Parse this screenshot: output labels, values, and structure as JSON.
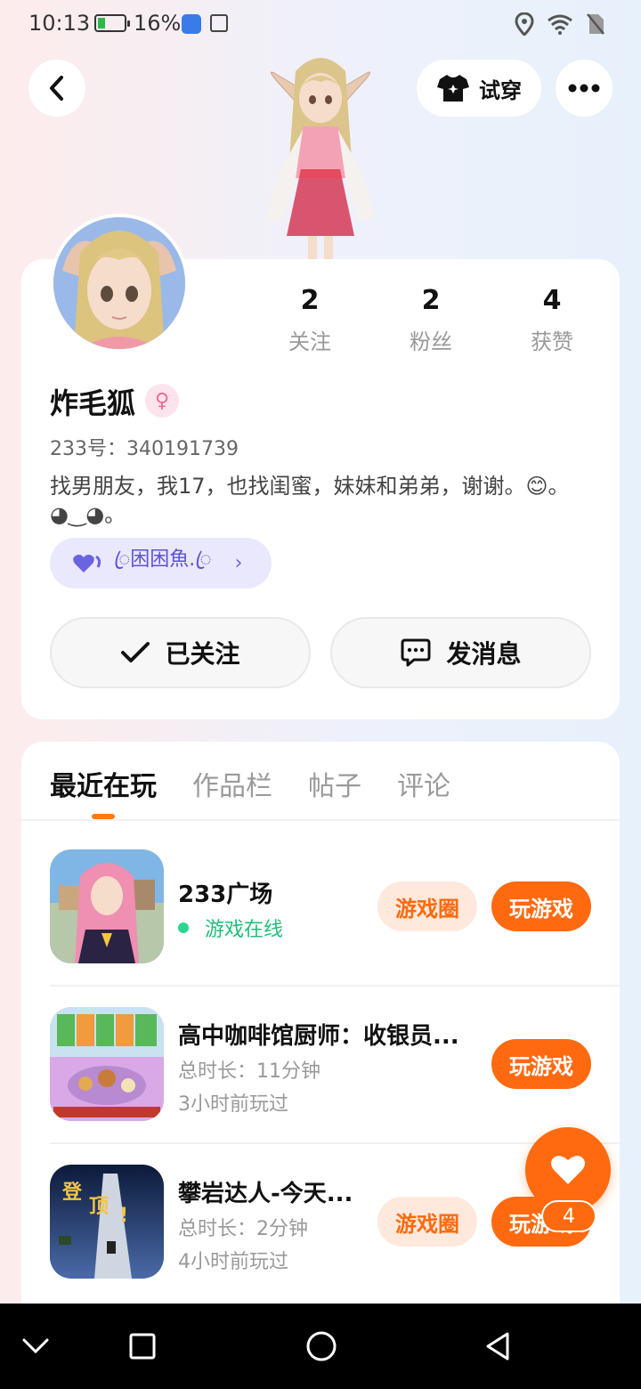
{
  "status_bar": {
    "time": "10:13",
    "battery_pct": "16%",
    "battery_level": 0.16
  },
  "header": {
    "tryon_label": "试穿"
  },
  "profile": {
    "stats": [
      {
        "num": "2",
        "label": "关注"
      },
      {
        "num": "2",
        "label": "粉丝"
      },
      {
        "num": "4",
        "label": "获赞"
      }
    ],
    "nickname": "炸毛狐",
    "gender_symbol": "♀",
    "uid": "233号：340191739",
    "bio": "找男朋友，我17，也找闺蜜，妹妹和弟弟，谢谢。😊。◕‿◕。",
    "tag": "ꦿ困困魚.ꦿ",
    "followed_label": "已关注",
    "message_label": "发消息"
  },
  "tabs": [
    "最近在玩",
    "作品栏",
    "帖子",
    "评论"
  ],
  "games": [
    {
      "title": "233广场",
      "status": "游戏在线",
      "circle": "游戏圈",
      "play": "玩游戏"
    },
    {
      "title": "高中咖啡馆厨师：收银员...",
      "duration": "总时长：11分钟",
      "last": "3小时前玩过",
      "play": "玩游戏"
    },
    {
      "title": "攀岩达人-今天...",
      "duration": "总时长：2分钟",
      "last": "4小时前玩过",
      "circle": "游戏圈",
      "play": "玩游戏",
      "icon_text1": "登",
      "icon_text2": "顶",
      "icon_text3": "!"
    }
  ],
  "fab": {
    "count": "4"
  },
  "colors": {
    "accent": "#ff6a10",
    "accent_light": "#ffe9dc",
    "online": "#1fbf7a",
    "tag_bg": "#eae8fc",
    "tag_text": "#5b52d6"
  }
}
